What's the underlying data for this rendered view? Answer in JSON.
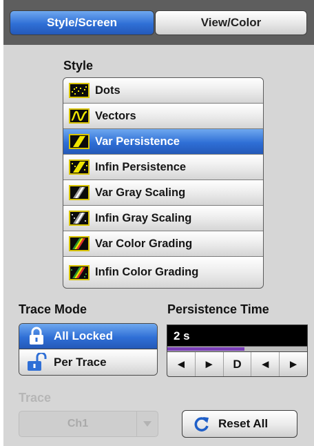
{
  "tabs": [
    {
      "label": "Style/Screen",
      "active": true
    },
    {
      "label": "View/Color",
      "active": false
    }
  ],
  "style": {
    "heading": "Style",
    "selected_index": 2,
    "items": [
      {
        "label": "Dots",
        "icon": "dots-icon"
      },
      {
        "label": "Vectors",
        "icon": "vectors-icon"
      },
      {
        "label": "Var Persistence",
        "icon": "var-persistence-icon"
      },
      {
        "label": "Infin Persistence",
        "icon": "infin-persistence-icon"
      },
      {
        "label": "Var Gray Scaling",
        "icon": "var-gray-scaling-icon"
      },
      {
        "label": "Infin Gray Scaling",
        "icon": "infin-gray-scaling-icon"
      },
      {
        "label": "Var Color Grading",
        "icon": "var-color-grading-icon"
      },
      {
        "label": "Infin Color Grading",
        "icon": "infin-color-grading-icon"
      }
    ]
  },
  "trace_mode": {
    "heading": "Trace Mode",
    "options": [
      {
        "label": "All Locked",
        "selected": true,
        "icon": "lock-closed-icon"
      },
      {
        "label": "Per Trace",
        "selected": false,
        "icon": "lock-open-icon"
      }
    ]
  },
  "persistence_time": {
    "heading": "Persistence Time",
    "value": "2 s",
    "level_fraction": 0.55,
    "controls": [
      "◄",
      "►",
      "D",
      "◄",
      "►"
    ]
  },
  "trace": {
    "heading": "Trace",
    "value": "Ch1",
    "enabled": false
  },
  "reset_all": {
    "label": "Reset All",
    "icon": "reset-icon"
  },
  "colors": {
    "selected_blue": "#2f6fd6",
    "panel_gray": "#d6d6d6",
    "icon_border_yellow": "#d8c300",
    "persistence_bar": "#7a3fb7",
    "reset_icon_blue": "#1f5fc8"
  }
}
